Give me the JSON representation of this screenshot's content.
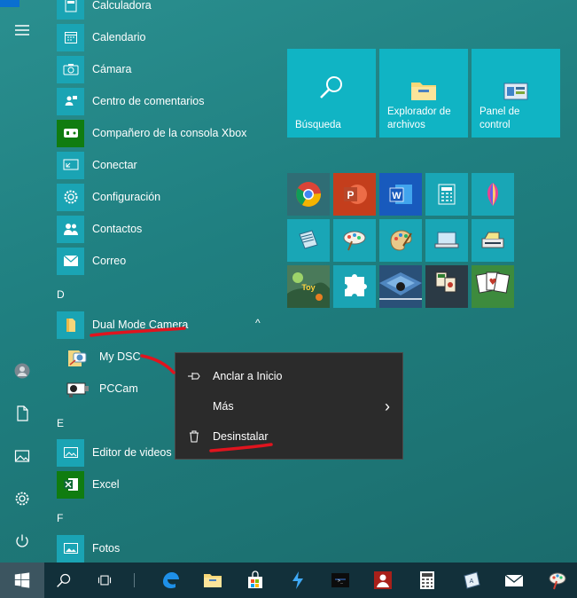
{
  "rail": {
    "items": [
      "menu-icon",
      "user-icon",
      "document-icon",
      "pictures-icon",
      "settings-icon",
      "power-icon"
    ]
  },
  "apps": {
    "items": [
      {
        "label": "Calculadora",
        "icon": "calculator-icon"
      },
      {
        "label": "Calendario",
        "icon": "calendar-icon"
      },
      {
        "label": "Cámara",
        "icon": "camera-icon"
      },
      {
        "label": "Centro de comentarios",
        "icon": "feedback-icon"
      },
      {
        "label": "Compañero de la consola Xbox",
        "icon": "xbox-icon"
      },
      {
        "label": "Conectar",
        "icon": "connect-icon"
      },
      {
        "label": "Configuración",
        "icon": "settings-icon"
      },
      {
        "label": "Contactos",
        "icon": "people-icon"
      },
      {
        "label": "Correo",
        "icon": "mail-icon"
      }
    ],
    "letter_d": "D",
    "dual_mode": {
      "label": "Dual Mode Camera",
      "icon": "folder-icon",
      "expanded_glyph": "^"
    },
    "sub_items": [
      {
        "label": "My DSC",
        "icon": "camera-app-icon"
      },
      {
        "label": "PCCam",
        "icon": "webcam-icon"
      }
    ],
    "letter_e": "E",
    "e_items": [
      {
        "label": "Editor de videos",
        "icon": "video-editor-icon"
      },
      {
        "label": "Excel",
        "icon": "excel-icon"
      }
    ],
    "letter_f": "F",
    "f_items": [
      {
        "label": "Fotos",
        "icon": "photos-icon"
      }
    ]
  },
  "tiles": {
    "large": [
      {
        "label": "Búsqueda",
        "icon": "search-icon"
      },
      {
        "label": "Explorador de archivos",
        "icon": "folder-icon"
      },
      {
        "label": "Panel de control",
        "icon": "control-panel-icon"
      }
    ],
    "small": [
      "chrome-icon",
      "powerpoint-icon",
      "word-icon",
      "calculator-icon",
      "paint3d-icon",
      "app-icon",
      "paint-icon",
      "paint-palette-icon",
      "remote-desktop-icon",
      "scanner-icon",
      "game-icon",
      "puzzle-icon",
      "minesweeper-icon",
      "mahjong-icon",
      "solitaire-icon"
    ]
  },
  "context_menu": {
    "items": [
      {
        "label": "Anclar a Inicio",
        "icon": "pin-icon"
      },
      {
        "label": "Más",
        "icon": "",
        "submenu_glyph": "›"
      },
      {
        "label": "Desinstalar",
        "icon": "trash-icon"
      }
    ]
  },
  "taskbar": {
    "items": [
      "start-icon",
      "search-icon",
      "task-view-icon",
      "edge-icon",
      "file-explorer-icon",
      "store-icon",
      "app-icon",
      "terminal-icon",
      "user-app-icon",
      "calculator-icon",
      "app-icon",
      "mail-icon",
      "paint-icon"
    ]
  },
  "colors": {
    "accent": "#10b4c4",
    "taskbar": "#12303a",
    "menu": "#2b2b2b",
    "annotation": "#e0141e"
  }
}
